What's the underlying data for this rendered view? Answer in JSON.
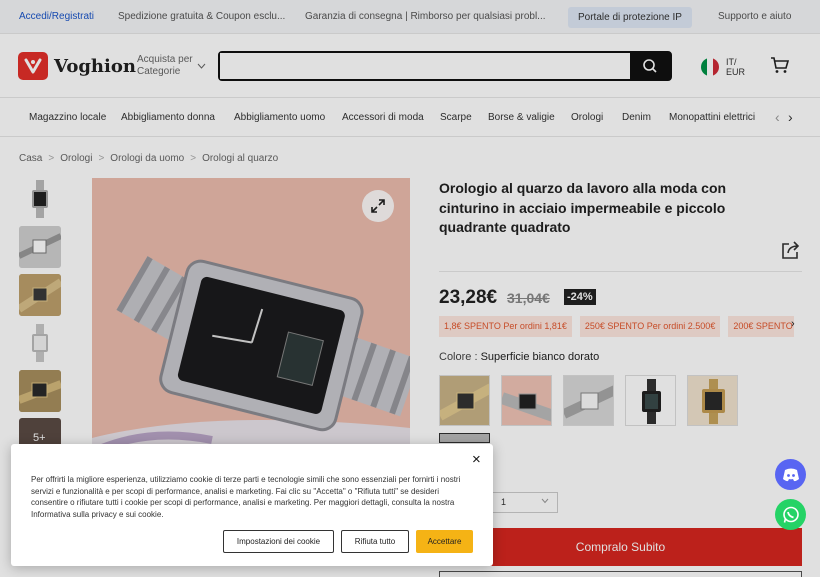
{
  "topbar": {
    "login": "Accedi/Registrati",
    "shipping": "Spedizione gratuita & Coupon esclu...",
    "guarantee": "Garanzia di consegna | Rimborso per qualsiasi probl...",
    "ip_portal": "Portale di protezione IP",
    "support": "Supporto e aiuto"
  },
  "header": {
    "logo_text": "Voghion",
    "categories_line1": "Acquista per",
    "categories_line2": "Categorie",
    "search_placeholder": "",
    "lang_line1": "IT/",
    "lang_line2": "EUR"
  },
  "nav": {
    "items": [
      "Magazzino locale",
      "Abbigliamento donna",
      "Abbigliamento uomo",
      "Accessori di moda",
      "Scarpe",
      "Borse & valigie",
      "Orologi",
      "Denim",
      "Monopattini elettrici"
    ],
    "prev": "‹",
    "next": "›"
  },
  "breadcrumb": [
    "Casa",
    "Orologi",
    "Orologi da uomo",
    "Orologi al quarzo"
  ],
  "thumbs": {
    "more_label": "5+"
  },
  "product": {
    "title": "Orologio al quarzo da lavoro alla moda con cinturino in acciaio impermeabile e piccolo quadrante quadrato",
    "price": "23,28€",
    "old_price": "31,04€",
    "discount": "-24%",
    "coupons": [
      "1,8€ SPENTO Per ordini 1,81€",
      "250€ SPENTO Per ordini 2.500€",
      "200€ SPENTO"
    ],
    "color_label": "Colore : ",
    "color_value": "Superficie bianco dorato",
    "quantity": "1",
    "buy_label": "Compralo Subito"
  },
  "cookie": {
    "text": "Per offrirti la migliore esperienza, utilizziamo cookie di terze parti e tecnologie simili che sono essenziali per fornirti i nostri servizi e funzionalità e per scopi di performance, analisi e marketing. Fai clic su \"Accetta\" o \"Rifiuta tutti\" se desideri consentire o rifiutare tutti i cookie per scopi di performance, analisi e marketing. Per maggiori dettagli, consulta la nostra Informativa sulla privacy e sui cookie.",
    "settings": "Impostazioni dei cookie",
    "reject": "Rifiuta tutto",
    "accept": "Accettare",
    "close": "×"
  },
  "colors": {
    "brand_red": "#e32f2a",
    "buy_red": "#d6261f",
    "accept_yellow": "#f5b315",
    "link_blue": "#1a55c9",
    "discord": "#5865f2",
    "whatsapp": "#25d366"
  }
}
